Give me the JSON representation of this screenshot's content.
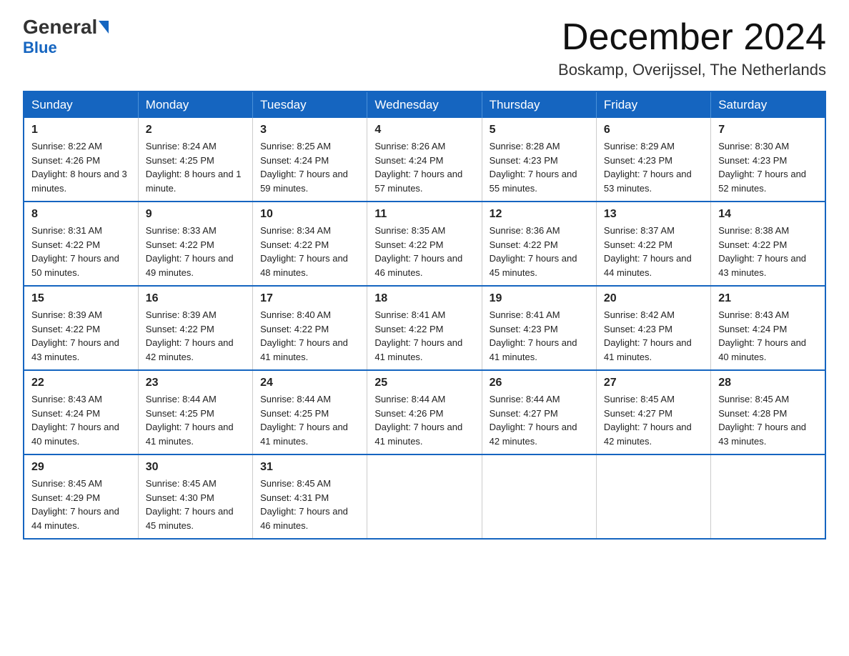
{
  "header": {
    "logo_general": "General",
    "logo_blue": "Blue",
    "month_title": "December 2024",
    "subtitle": "Boskamp, Overijssel, The Netherlands"
  },
  "weekdays": [
    "Sunday",
    "Monday",
    "Tuesday",
    "Wednesday",
    "Thursday",
    "Friday",
    "Saturday"
  ],
  "weeks": [
    [
      {
        "day": "1",
        "sunrise": "8:22 AM",
        "sunset": "4:26 PM",
        "daylight": "8 hours and 3 minutes."
      },
      {
        "day": "2",
        "sunrise": "8:24 AM",
        "sunset": "4:25 PM",
        "daylight": "8 hours and 1 minute."
      },
      {
        "day": "3",
        "sunrise": "8:25 AM",
        "sunset": "4:24 PM",
        "daylight": "7 hours and 59 minutes."
      },
      {
        "day": "4",
        "sunrise": "8:26 AM",
        "sunset": "4:24 PM",
        "daylight": "7 hours and 57 minutes."
      },
      {
        "day": "5",
        "sunrise": "8:28 AM",
        "sunset": "4:23 PM",
        "daylight": "7 hours and 55 minutes."
      },
      {
        "day": "6",
        "sunrise": "8:29 AM",
        "sunset": "4:23 PM",
        "daylight": "7 hours and 53 minutes."
      },
      {
        "day": "7",
        "sunrise": "8:30 AM",
        "sunset": "4:23 PM",
        "daylight": "7 hours and 52 minutes."
      }
    ],
    [
      {
        "day": "8",
        "sunrise": "8:31 AM",
        "sunset": "4:22 PM",
        "daylight": "7 hours and 50 minutes."
      },
      {
        "day": "9",
        "sunrise": "8:33 AM",
        "sunset": "4:22 PM",
        "daylight": "7 hours and 49 minutes."
      },
      {
        "day": "10",
        "sunrise": "8:34 AM",
        "sunset": "4:22 PM",
        "daylight": "7 hours and 48 minutes."
      },
      {
        "day": "11",
        "sunrise": "8:35 AM",
        "sunset": "4:22 PM",
        "daylight": "7 hours and 46 minutes."
      },
      {
        "day": "12",
        "sunrise": "8:36 AM",
        "sunset": "4:22 PM",
        "daylight": "7 hours and 45 minutes."
      },
      {
        "day": "13",
        "sunrise": "8:37 AM",
        "sunset": "4:22 PM",
        "daylight": "7 hours and 44 minutes."
      },
      {
        "day": "14",
        "sunrise": "8:38 AM",
        "sunset": "4:22 PM",
        "daylight": "7 hours and 43 minutes."
      }
    ],
    [
      {
        "day": "15",
        "sunrise": "8:39 AM",
        "sunset": "4:22 PM",
        "daylight": "7 hours and 43 minutes."
      },
      {
        "day": "16",
        "sunrise": "8:39 AM",
        "sunset": "4:22 PM",
        "daylight": "7 hours and 42 minutes."
      },
      {
        "day": "17",
        "sunrise": "8:40 AM",
        "sunset": "4:22 PM",
        "daylight": "7 hours and 41 minutes."
      },
      {
        "day": "18",
        "sunrise": "8:41 AM",
        "sunset": "4:22 PM",
        "daylight": "7 hours and 41 minutes."
      },
      {
        "day": "19",
        "sunrise": "8:41 AM",
        "sunset": "4:23 PM",
        "daylight": "7 hours and 41 minutes."
      },
      {
        "day": "20",
        "sunrise": "8:42 AM",
        "sunset": "4:23 PM",
        "daylight": "7 hours and 41 minutes."
      },
      {
        "day": "21",
        "sunrise": "8:43 AM",
        "sunset": "4:24 PM",
        "daylight": "7 hours and 40 minutes."
      }
    ],
    [
      {
        "day": "22",
        "sunrise": "8:43 AM",
        "sunset": "4:24 PM",
        "daylight": "7 hours and 40 minutes."
      },
      {
        "day": "23",
        "sunrise": "8:44 AM",
        "sunset": "4:25 PM",
        "daylight": "7 hours and 41 minutes."
      },
      {
        "day": "24",
        "sunrise": "8:44 AM",
        "sunset": "4:25 PM",
        "daylight": "7 hours and 41 minutes."
      },
      {
        "day": "25",
        "sunrise": "8:44 AM",
        "sunset": "4:26 PM",
        "daylight": "7 hours and 41 minutes."
      },
      {
        "day": "26",
        "sunrise": "8:44 AM",
        "sunset": "4:27 PM",
        "daylight": "7 hours and 42 minutes."
      },
      {
        "day": "27",
        "sunrise": "8:45 AM",
        "sunset": "4:27 PM",
        "daylight": "7 hours and 42 minutes."
      },
      {
        "day": "28",
        "sunrise": "8:45 AM",
        "sunset": "4:28 PM",
        "daylight": "7 hours and 43 minutes."
      }
    ],
    [
      {
        "day": "29",
        "sunrise": "8:45 AM",
        "sunset": "4:29 PM",
        "daylight": "7 hours and 44 minutes."
      },
      {
        "day": "30",
        "sunrise": "8:45 AM",
        "sunset": "4:30 PM",
        "daylight": "7 hours and 45 minutes."
      },
      {
        "day": "31",
        "sunrise": "8:45 AM",
        "sunset": "4:31 PM",
        "daylight": "7 hours and 46 minutes."
      },
      null,
      null,
      null,
      null
    ]
  ]
}
